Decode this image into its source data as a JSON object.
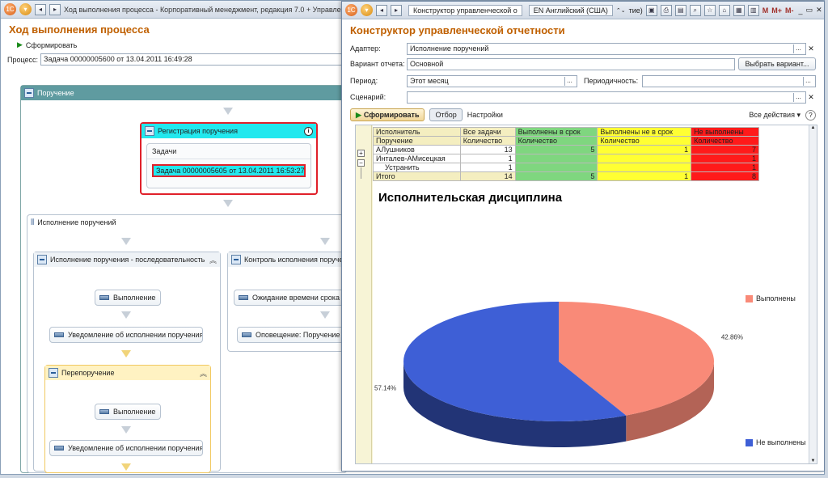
{
  "left_window": {
    "title": "Ход выполнения процесса - Корпоративный менеджмент, редакция 7.0 + Управление",
    "heading": "Ход выполнения процесса",
    "generate_label": "Сформировать",
    "process_label": "Процесс:",
    "process_value": "Задача 00000005600 от 13.04.2011 16:49:28",
    "root_node": "Поручение",
    "registration_node": "Регистрация поручения",
    "tasks_label": "Задачи",
    "task_value": "Задача 00000005605 от 13.04.2011 16:53:27",
    "execution_node": "Исполнение поручений",
    "sequence_node": "Исполнение поручения - последовательность",
    "control_node": "Контроль исполнения поруче",
    "step_execution": "Выполнение",
    "step_notify": "Уведомление об исполнении поручения",
    "step_wait": "Ожидание времени срока и",
    "step_alert": "Оповещение: Поручение",
    "reassign_node": "Перепоручение",
    "step_execution2": "Выполнение",
    "step_notify2": "Уведомление об исполнении поручения"
  },
  "right_window": {
    "title": "Конструктор управленческой о",
    "lang": "EN Английский (США)",
    "lang_extra": "тие)",
    "toolbar_m": "M",
    "toolbar_mplus": "M+",
    "toolbar_mminus": "M-",
    "heading": "Конструктор управленческой отчетности",
    "adapter_label": "Адаптер:",
    "adapter_value": "Исполнение поручений",
    "variant_label": "Вариант отчета:",
    "variant_value": "Основной",
    "choose_variant": "Выбрать вариант...",
    "period_label": "Период:",
    "period_value": "Этот месяц",
    "periodicity_label": "Периодичность:",
    "scenario_label": "Сценарий:",
    "generate_label": "Сформировать",
    "filter_label": "Отбор",
    "settings_label": "Настройки",
    "all_actions": "Все действия",
    "help": "?",
    "table": {
      "h1": [
        "Исполнитель",
        "Все задачи",
        "Выполнены в срок",
        "Выполнены не в срок",
        "Не выполнены"
      ],
      "h2": [
        "Поручение",
        "Количество",
        "Количество",
        "Количество",
        "Количество"
      ],
      "rows": [
        {
          "name": "АЛушников",
          "all": "13",
          "ontime": "5",
          "late": "1",
          "notdone": "7",
          "indent": 0
        },
        {
          "name": "Инталев-АМисецкая",
          "all": "1",
          "ontime": "",
          "late": "",
          "notdone": "1",
          "indent": 0
        },
        {
          "name": "Устранить",
          "all": "1",
          "ontime": "",
          "late": "",
          "notdone": "1",
          "indent": 1
        }
      ],
      "total": {
        "name": "Итого",
        "all": "14",
        "ontime": "5",
        "late": "1",
        "notdone": "8"
      }
    }
  },
  "chart_data": {
    "type": "pie",
    "title": "Исполнительская дисциплина",
    "slices": [
      {
        "label": "Выполнены",
        "value": 42.86,
        "pct_label": "42.86%",
        "color": "#f98a78"
      },
      {
        "label": "Не выполнены",
        "value": 57.14,
        "pct_label": "57.14%",
        "color": "#3e5fd6"
      }
    ],
    "legend_position": "right"
  }
}
